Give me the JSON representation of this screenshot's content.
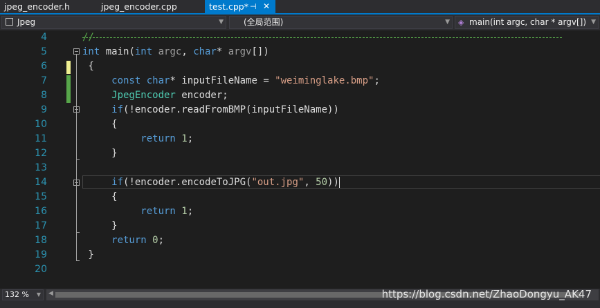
{
  "tabs": [
    {
      "label": "jpeg_encoder.h"
    },
    {
      "label": "jpeg_encoder.cpp"
    },
    {
      "label": "test.cpp*",
      "pin": "⊣",
      "close": "✕"
    }
  ],
  "nav": {
    "project": "Jpeg",
    "scope": "(全局范围)",
    "member": "main(int argc, char * argv[])"
  },
  "lines": [
    {
      "n": "4"
    },
    {
      "n": "5",
      "t1": "int",
      "t2": " main(",
      "t3": "int",
      "t4": " ",
      "t5": "argc",
      "t6": ", ",
      "t7": "char",
      "t8": "* ",
      "t9": "argv",
      "t10": "[])"
    },
    {
      "n": "6",
      "t": " {"
    },
    {
      "n": "7",
      "t1": "     const",
      "t2": " ",
      "t3": "char",
      "t4": "* inputFileName = ",
      "t5": "\"weiminglake.bmp\"",
      "t6": ";"
    },
    {
      "n": "8",
      "t1": "     JpegEncoder",
      "t2": " encoder;"
    },
    {
      "n": "9",
      "t1": "     if",
      "t2": "(!encoder.readFromBMP(inputFileName))"
    },
    {
      "n": "10",
      "t": "     {"
    },
    {
      "n": "11",
      "t1": "          return",
      "t2": " ",
      "t3": "1",
      "t4": ";"
    },
    {
      "n": "12",
      "t": "     }"
    },
    {
      "n": "13"
    },
    {
      "n": "14",
      "t1": "     if",
      "t2": "(!encoder.encodeToJPG(",
      "t3": "\"out.jpg\"",
      "t4": ", ",
      "t5": "50",
      "t6": "))"
    },
    {
      "n": "15",
      "t": "     {"
    },
    {
      "n": "16",
      "t1": "          return",
      "t2": " ",
      "t3": "1",
      "t4": ";"
    },
    {
      "n": "17",
      "t": "     }"
    },
    {
      "n": "18",
      "t1": "     return",
      "t2": " ",
      "t3": "0",
      "t4": ";"
    },
    {
      "n": "19",
      "t": " }"
    },
    {
      "n": "20"
    }
  ],
  "zoom": "132 %",
  "watermark": "https://blog.csdn.net/ZhaoDongyu_AK47",
  "colors": {
    "accent": "#007acc",
    "keyword": "#569cd6",
    "type": "#4ec9b0",
    "string": "#d69d85",
    "comment": "#57a64a",
    "lineNumber": "#2b91af"
  }
}
